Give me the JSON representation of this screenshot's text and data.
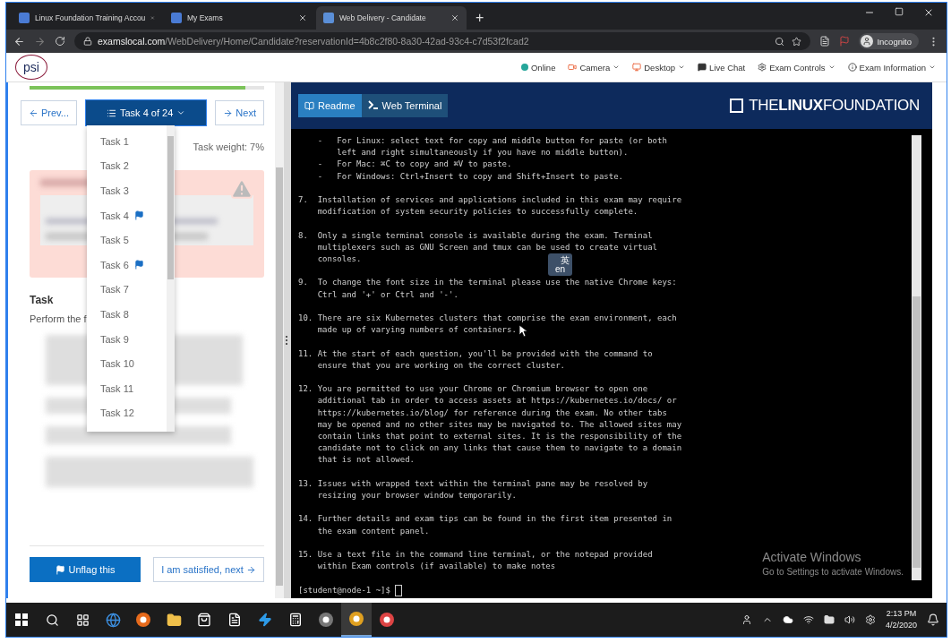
{
  "browser": {
    "tabs": [
      {
        "title": "Linux Foundation Training Accou",
        "selected": false
      },
      {
        "title": "My Exams",
        "selected": false
      },
      {
        "title": "Web Delivery - Candidate",
        "selected": true
      }
    ],
    "new_tab": "+",
    "url_host": "examslocal.com",
    "url_path": "/WebDelivery/Home/Candidate?reservationId=4b8c2f80-8a30-42ad-93c4-c7d53f2fcad2",
    "profile": "Incognito"
  },
  "header": {
    "logo": "psi",
    "items": [
      {
        "label": "Online",
        "kind": "status",
        "dropdown": false
      },
      {
        "label": "Camera",
        "kind": "camera",
        "dropdown": true
      },
      {
        "label": "Desktop",
        "kind": "desktop",
        "dropdown": true
      },
      {
        "label": "Live Chat",
        "kind": "chat",
        "dropdown": false
      },
      {
        "label": "Exam Controls",
        "kind": "controls",
        "dropdown": true
      },
      {
        "label": "Exam Information",
        "kind": "info",
        "dropdown": true
      }
    ]
  },
  "task_panel": {
    "progress": {
      "level": 0.92
    },
    "prev": "Prev...",
    "task_menu": "Task 4 of 24",
    "next": "Next",
    "weight": "Task weight: 7%",
    "heading": "Task",
    "intro": "Perform the f",
    "unflag": "Unflag this",
    "satisfied": "I am satisfied, next"
  },
  "task_list": [
    {
      "label": "Task 1",
      "flagged": false
    },
    {
      "label": "Task 2",
      "flagged": false
    },
    {
      "label": "Task 3",
      "flagged": false
    },
    {
      "label": "Task 4",
      "flagged": true
    },
    {
      "label": "Task 5",
      "flagged": false
    },
    {
      "label": "Task 6",
      "flagged": true
    },
    {
      "label": "Task 7",
      "flagged": false
    },
    {
      "label": "Task 8",
      "flagged": false
    },
    {
      "label": "Task 9",
      "flagged": false
    },
    {
      "label": "Task 10",
      "flagged": false
    },
    {
      "label": "Task 11",
      "flagged": false
    },
    {
      "label": "Task 12",
      "flagged": false
    }
  ],
  "terminal": {
    "tabs": [
      {
        "label": "Readme",
        "kind": "readme",
        "selected": true
      },
      {
        "label": "Web Terminal",
        "kind": "terminal",
        "selected": false
      }
    ],
    "logo": "THE**LINUX**FOUNDATION",
    "blocks": [
      [
        "    -   For Linux: select text for copy and middle button for paste (or both",
        "        left and right simultaneously if you have no middle button).",
        "    -   For Mac: ⌘C to copy and ⌘V to paste.",
        "    -   For Windows: Ctrl+Insert to copy and Shift+Insert to paste."
      ],
      [
        "7.  Installation of services and applications included in this exam may require",
        "    modification of system security policies to successfully complete."
      ],
      [
        "8.  Only a single terminal console is available during the exam. Terminal",
        "    multiplexers such as GNU Screen and tmux can be used to create virtual",
        "    consoles."
      ],
      [
        "9.  To change the font size in the terminal please use the native Chrome keys:",
        "    Ctrl and '+' or Ctrl and '-'."
      ],
      [
        "10. There are six Kubernetes clusters that comprise the exam environment, each",
        "    made up of varying numbers of containers."
      ],
      [
        "11. At the start of each question, you'll be provided with the command to",
        "    ensure that you are working on the correct cluster."
      ],
      [
        "12. You are permitted to use your Chrome or Chromium browser to open one",
        "    additional tab in order to access assets at https://kubernetes.io/docs/ or",
        "    https://kubernetes.io/blog/ for reference during the exam. No other tabs",
        "    may be opened and no other sites may be navigated to. The allowed sites may",
        "    contain links that point to external sites. It is the responsibility of the",
        "    candidate not to click on any links that cause them to navigate to a domain",
        "    that is not allowed."
      ],
      [
        "13. Issues with wrapped text within the terminal pane may be resolved by",
        "    resizing your browser window temporarily."
      ],
      [
        "14. Further details and exam tips can be found in the first item presented in",
        "    the exam content panel."
      ],
      [
        "15. Use a text file in the command line terminal, or the notepad provided",
        "    within Exam controls (if available) to make notes"
      ]
    ],
    "prompt": "[student@node-1 ~]$"
  },
  "ime": {
    "glyph": "英",
    "label": "en"
  },
  "activation": {
    "title": "Activate Windows",
    "subtitle": "Go to Settings to activate Windows."
  },
  "taskbar": {
    "time": "2:13 PM",
    "date": "4/2/2020"
  }
}
